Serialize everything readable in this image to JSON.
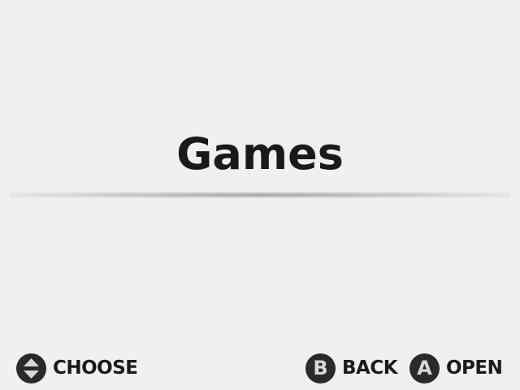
{
  "menu": {
    "title": "Games"
  },
  "hints": {
    "choose": {
      "icon": "dpad-up-down-icon",
      "label": "CHOOSE"
    },
    "back": {
      "icon": "b-button-icon",
      "glyph": "B",
      "label": "BACK"
    },
    "open": {
      "icon": "a-button-icon",
      "glyph": "A",
      "label": "OPEN"
    }
  },
  "colors": {
    "background": "#f0f0f0",
    "text": "#1a1a1a",
    "button_fill": "#2a2a2a",
    "button_glyph": "#d8d8d8"
  }
}
